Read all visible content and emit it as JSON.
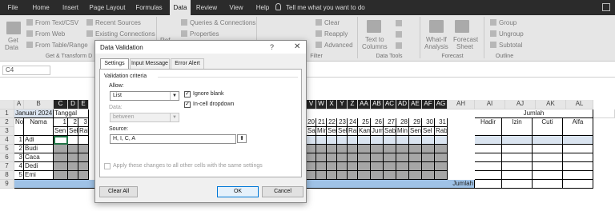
{
  "ribbon_tabs": [
    "File",
    "Home",
    "Insert",
    "Page Layout",
    "Formulas",
    "Data",
    "Review",
    "View",
    "Help"
  ],
  "active_tab": "Data",
  "tell_me": "Tell me what you want to do",
  "ribbon": {
    "get_data": [
      "Get",
      "Data"
    ],
    "from_text": "From Text/CSV",
    "from_web": "From Web",
    "from_table": "From Table/Range",
    "recent_sources": "Recent Sources",
    "existing_connections": "Existing Connections",
    "refresh_fragment": "Ref",
    "queries": "Queries & Connections",
    "properties": "Properties",
    "clear": "Clear",
    "reapply": "Reapply",
    "advanced": "Advanced",
    "text_to_columns": [
      "Text to",
      "Columns"
    ],
    "whatif": [
      "What-If",
      "Analysis"
    ],
    "forecast": [
      "Forecast",
      "Sheet"
    ],
    "group": "Group",
    "ungroup": "Ungroup",
    "subtotal": "Subtotal",
    "groups": {
      "get_transform": "Get & Transform D",
      "filter": "Filter",
      "data_tools": "Data Tools",
      "forecast": "Forecast",
      "outline": "Outline"
    }
  },
  "name_box": "C4",
  "sheet": {
    "col_headers_left": [
      "A",
      "B",
      "C",
      "D",
      "E"
    ],
    "col_headers_right": [
      "V",
      "W",
      "X",
      "Y",
      "Z",
      "AA",
      "AB",
      "AC",
      "AD",
      "AE",
      "AF",
      "AG",
      "AH",
      "AI",
      "AJ",
      "AK",
      "AL"
    ],
    "row_headers": [
      "1",
      "2",
      "3",
      "4",
      "5",
      "6",
      "7",
      "8",
      "9"
    ],
    "title": "Januari 2024",
    "tanggal": "Tanggal",
    "no_header": "No",
    "nama_header": "Nama",
    "days_left": [
      "1",
      "2",
      "3"
    ],
    "weekdays_left": [
      "Sen",
      "Sel",
      "Rab"
    ],
    "days_right": [
      "20",
      "21",
      "22",
      "23",
      "24",
      "25",
      "26",
      "27",
      "28",
      "29",
      "30",
      "31"
    ],
    "weekdays_right": [
      "Sab",
      "Min",
      "Sen",
      "Sel",
      "Rab",
      "Kam",
      "Jum",
      "Sab",
      "Min",
      "Sen",
      "Sel",
      "Rab"
    ],
    "day_right_partial": "19",
    "weekday_right_partial": "Jum",
    "jumlah_header": "Jumlah",
    "jumlah_cols": [
      "Hadir",
      "Izin",
      "Cuti",
      "Alfa"
    ],
    "students": [
      {
        "no": "1",
        "name": "Adi"
      },
      {
        "no": "2",
        "name": "Budi"
      },
      {
        "no": "3",
        "name": "Caca"
      },
      {
        "no": "4",
        "name": "Dedi"
      },
      {
        "no": "5",
        "name": "Emi"
      }
    ],
    "jumlah_row": "Jumlah"
  },
  "dialog": {
    "title": "Data Validation",
    "help": "?",
    "close": "✕",
    "tabs": [
      "Settings",
      "Input Message",
      "Error Alert"
    ],
    "active_tab": "Settings",
    "criteria": "Validation criteria",
    "allow_label": "Allow:",
    "allow_value": "List",
    "data_label": "Data:",
    "data_value": "between",
    "ignore_blank": "Ignore blank",
    "ignore_blank_checked": true,
    "in_cell_dropdown": "In-cell dropdown",
    "in_cell_dropdown_checked": true,
    "source_label": "Source:",
    "source_value": "H, I, C, A",
    "apply_all": "Apply these changes to all other cells with the same settings",
    "clear_all": "Clear All",
    "ok": "OK",
    "cancel": "Cancel"
  }
}
